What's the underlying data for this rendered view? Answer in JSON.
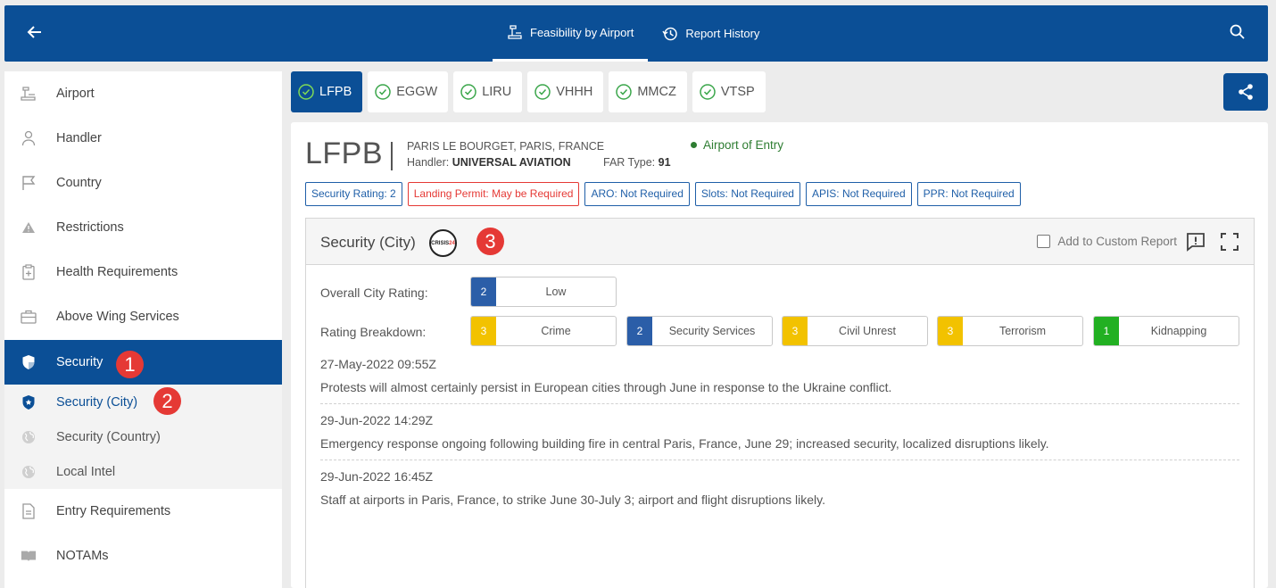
{
  "nav": {
    "tabs": [
      {
        "label": "Feasibility by Airport",
        "icon": "airport-tower-icon",
        "active": true
      },
      {
        "label": "Report History",
        "icon": "history-icon",
        "active": false
      }
    ]
  },
  "sidebar": {
    "items": [
      {
        "label": "Airport",
        "icon": "airport-tower-icon"
      },
      {
        "label": "Handler",
        "icon": "person-icon"
      },
      {
        "label": "Country",
        "icon": "flag-icon"
      },
      {
        "label": "Restrictions",
        "icon": "warning-icon"
      },
      {
        "label": "Health Requirements",
        "icon": "clipboard-plus-icon"
      },
      {
        "label": "Above Wing Services",
        "icon": "briefcase-icon"
      },
      {
        "label": "Security",
        "icon": "shield-icon",
        "active": true
      },
      {
        "label": "Entry Requirements",
        "icon": "document-icon"
      },
      {
        "label": "NOTAMs",
        "icon": "book-icon"
      }
    ],
    "sub_items": [
      {
        "label": "Security (City)",
        "icon": "shield-star-icon",
        "active": true
      },
      {
        "label": "Security (Country)",
        "icon": "globe-icon"
      },
      {
        "label": "Local Intel",
        "icon": "globe-icon"
      }
    ]
  },
  "markers": [
    "1",
    "2",
    "3"
  ],
  "airport_tabs": [
    {
      "code": "LFPB",
      "active": true
    },
    {
      "code": "EGGW"
    },
    {
      "code": "LIRU"
    },
    {
      "code": "VHHH"
    },
    {
      "code": "MMCZ"
    },
    {
      "code": "VTSP"
    }
  ],
  "airport": {
    "code": "LFPB",
    "name": "PARIS LE BOURGET, PARIS, FRANCE",
    "handler_label": "Handler:",
    "handler": "UNIVERSAL AVIATION",
    "far_label": "FAR Type:",
    "far": "91",
    "entry": "Airport of Entry"
  },
  "badges": [
    {
      "label": "Security Rating: 2",
      "style": "blue"
    },
    {
      "label": "Landing Permit: May be Required",
      "style": "red"
    },
    {
      "label": "ARO: Not Required",
      "style": "blue"
    },
    {
      "label": "Slots: Not Required",
      "style": "blue"
    },
    {
      "label": "APIS: Not Required",
      "style": "blue"
    },
    {
      "label": "PPR: Not Required",
      "style": "blue"
    }
  ],
  "panel": {
    "title": "Security (City)",
    "logo_text_a": "CRISIS",
    "logo_text_b": "24",
    "custom_report": "Add to Custom Report",
    "overall_label": "Overall City Rating:",
    "overall": {
      "value": "2",
      "label": "Low",
      "color": "#2b5ea8"
    },
    "breakdown_label": "Rating Breakdown:",
    "breakdown": [
      {
        "value": "3",
        "label": "Crime",
        "color": "#f2c200"
      },
      {
        "value": "2",
        "label": "Security Services",
        "color": "#2b5ea8"
      },
      {
        "value": "3",
        "label": "Civil Unrest",
        "color": "#f2c200"
      },
      {
        "value": "3",
        "label": "Terrorism",
        "color": "#f2c200"
      },
      {
        "value": "1",
        "label": "Kidnapping",
        "color": "#22b022"
      }
    ],
    "news": [
      {
        "time": "27-May-2022 09:55Z",
        "text": "Protests will almost certainly persist in European cities through June in response to the Ukraine conflict."
      },
      {
        "time": "29-Jun-2022 14:29Z",
        "text": "Emergency response ongoing following building fire in central Paris, France, June 29; increased security, localized disruptions likely."
      },
      {
        "time": "29-Jun-2022 16:45Z",
        "text": "Staff at airports in Paris, France, to strike June 30-July 3; airport and flight disruptions likely."
      }
    ]
  },
  "colors": {
    "brand": "#0b4f96",
    "accent_red": "#e53935",
    "green": "#2e7d32"
  }
}
